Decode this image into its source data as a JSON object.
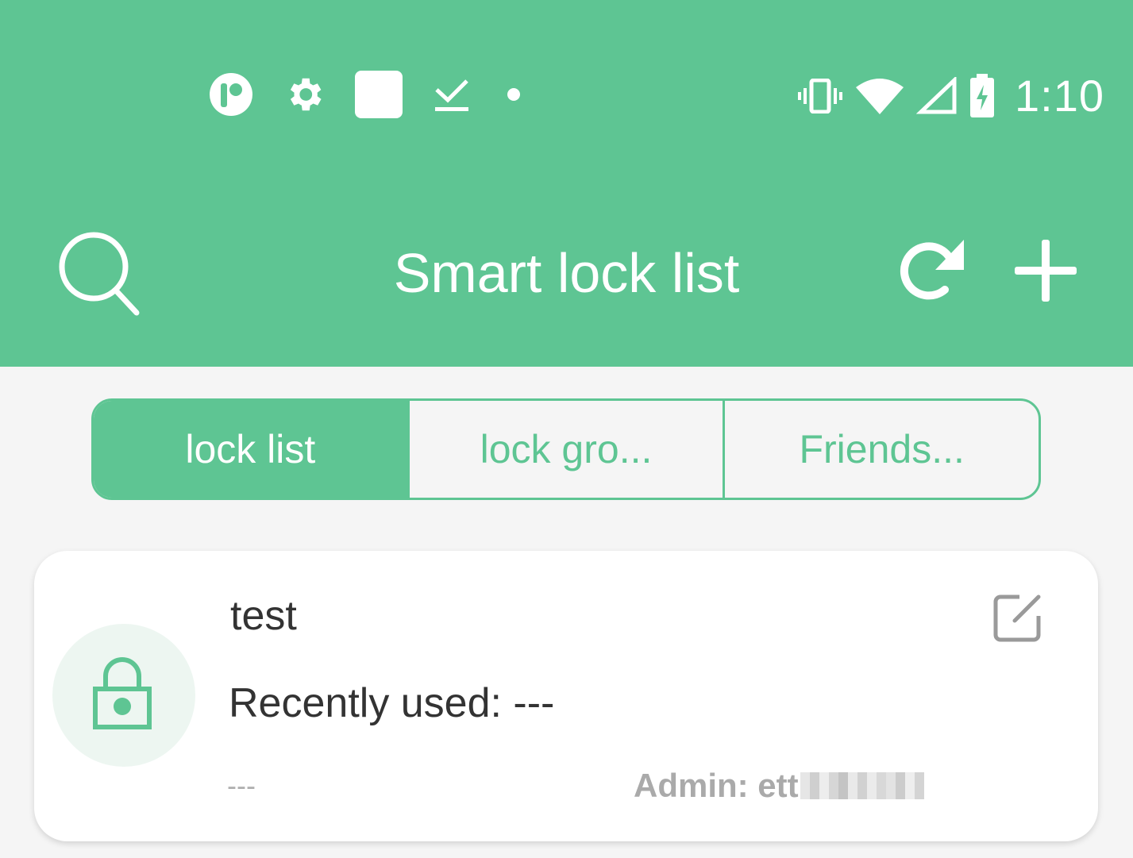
{
  "status_bar": {
    "left_icons": [
      "app-notification-icon",
      "settings-gear-icon",
      "square-notification-icon",
      "download-done-icon",
      "dot-icon"
    ],
    "right_icons": [
      "vibrate-icon",
      "wifi-icon",
      "cellular-signal-icon",
      "battery-charging-icon"
    ],
    "time": "1:10"
  },
  "app_bar": {
    "title": "Smart lock list",
    "left_icon": "search-icon",
    "right_icons": [
      "refresh-icon",
      "add-icon"
    ]
  },
  "tabs": [
    {
      "label": "lock list",
      "active": true
    },
    {
      "label": "lock gro...",
      "active": false
    },
    {
      "label": "Friends...",
      "active": false
    }
  ],
  "lock_card": {
    "name": "test",
    "recently_used": "Recently used: ---",
    "date": "---",
    "admin": "Admin: ett",
    "icon": "padlock-icon",
    "edit_icon": "edit-icon"
  },
  "colors": {
    "primary": "#5ec593",
    "background": "#f5f5f5",
    "card": "#ffffff",
    "text_dark": "#333333",
    "text_muted": "#aaaaaa",
    "lock_circle": "#edf6f1"
  }
}
